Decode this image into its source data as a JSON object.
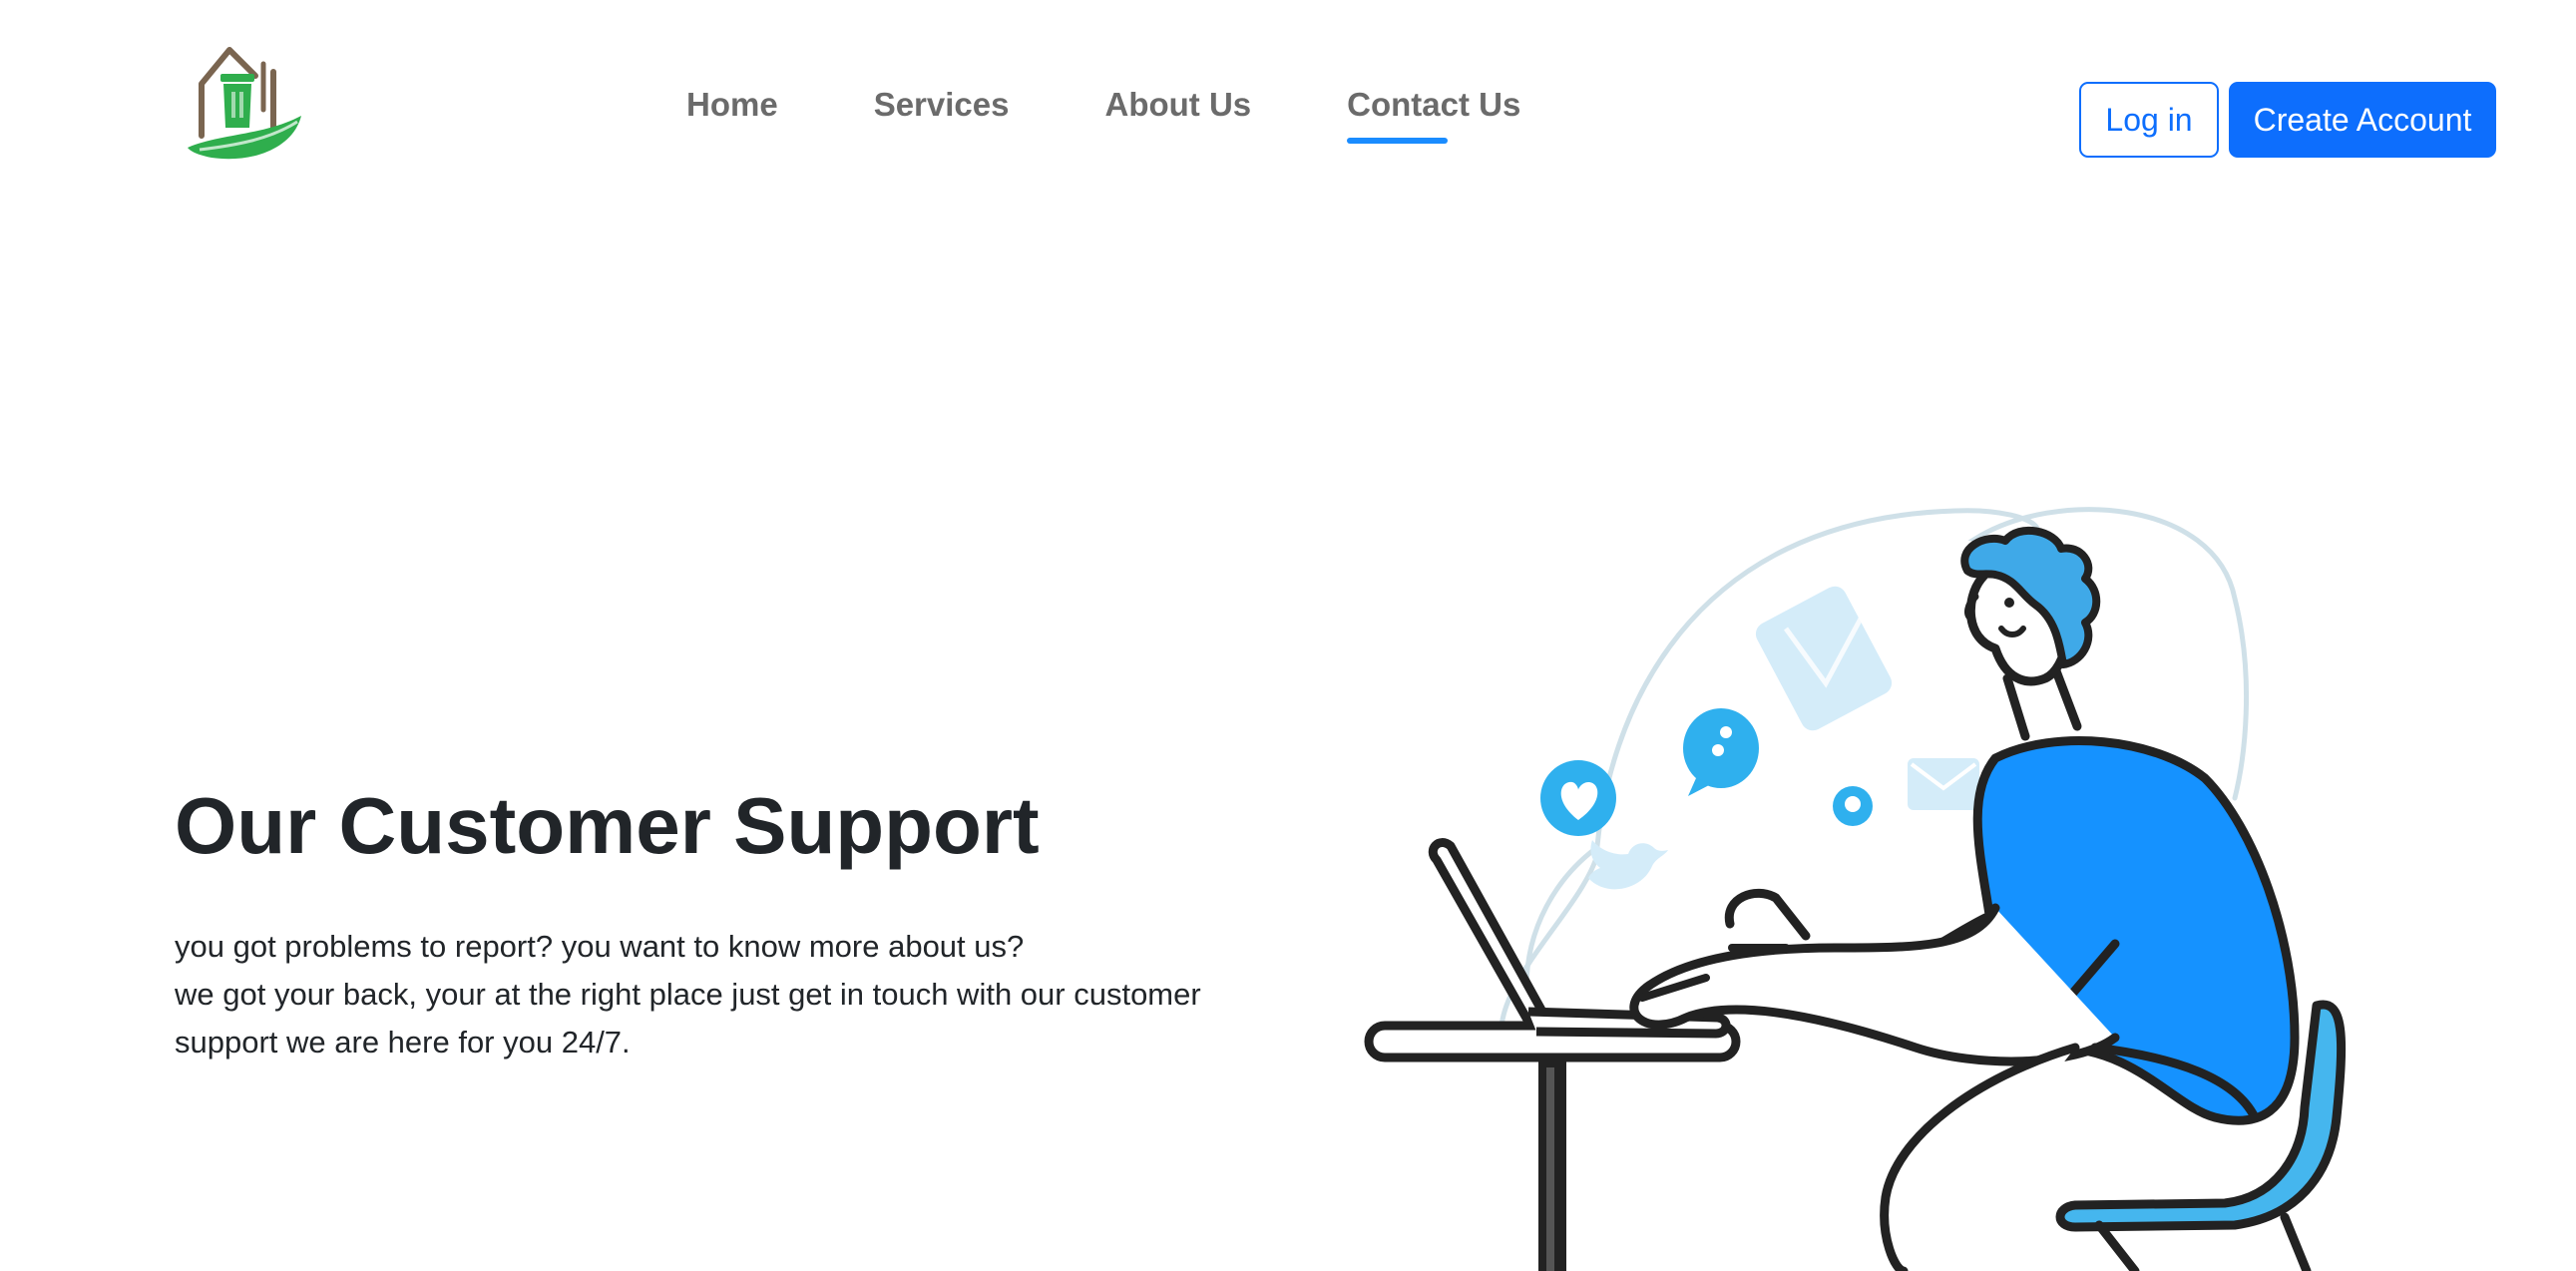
{
  "header": {
    "logo": {
      "icon": "eco-home-bin-leaf-icon"
    },
    "nav": {
      "items": [
        {
          "label": "Home"
        },
        {
          "label": "Services"
        },
        {
          "label": "About Us"
        },
        {
          "label": "Contact Us",
          "active": true
        }
      ]
    },
    "auth": {
      "login_label": "Log in",
      "create_label": "Create Account"
    }
  },
  "hero": {
    "title": "Our Customer Support",
    "text_line1": "you got problems to report? you want to know more about us?",
    "text_line2": "we got your back, your at the right place just get in touch with our customer support we are here for you 24/7.",
    "illustration": {
      "icon": "customer-support-person-at-laptop-illustration",
      "floating_icons": [
        "heart-bubble-icon",
        "chat-dots-icon",
        "mail-envelope-icon",
        "twitter-bird-icon",
        "location-pin-icon"
      ]
    }
  },
  "colors": {
    "primary": "#0d6efd",
    "nav_text": "#6b6b6b",
    "nav_active_underline": "#1a8cff",
    "heading": "#212529",
    "shirt_blue": "#1592ff",
    "hair_blue": "#3fa9e8",
    "chair_blue": "#45b6ee",
    "icon_light_blue": "#d4ecf9",
    "logo_brown": "#7a6550",
    "logo_green": "#2fae4d"
  }
}
